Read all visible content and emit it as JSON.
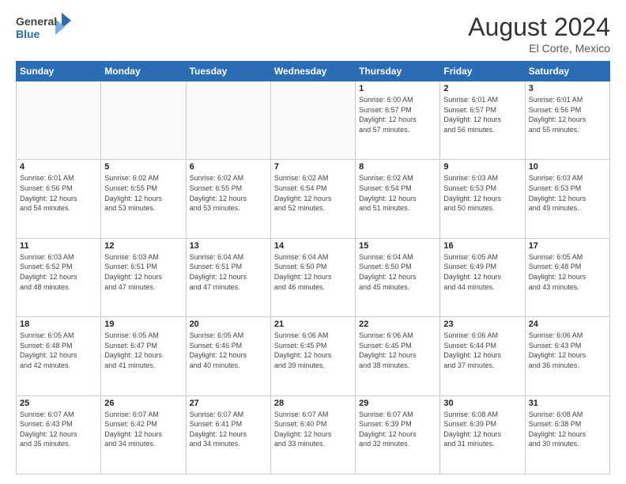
{
  "header": {
    "logo_general": "General",
    "logo_blue": "Blue",
    "month_year": "August 2024",
    "location": "El Corte, Mexico"
  },
  "days": [
    "Sunday",
    "Monday",
    "Tuesday",
    "Wednesday",
    "Thursday",
    "Friday",
    "Saturday"
  ],
  "weeks": [
    [
      {
        "date": "",
        "info": ""
      },
      {
        "date": "",
        "info": ""
      },
      {
        "date": "",
        "info": ""
      },
      {
        "date": "",
        "info": ""
      },
      {
        "date": "1",
        "info": "Sunrise: 6:00 AM\nSunset: 6:57 PM\nDaylight: 12 hours\nand 57 minutes."
      },
      {
        "date": "2",
        "info": "Sunrise: 6:01 AM\nSunset: 6:57 PM\nDaylight: 12 hours\nand 56 minutes."
      },
      {
        "date": "3",
        "info": "Sunrise: 6:01 AM\nSunset: 6:56 PM\nDaylight: 12 hours\nand 55 minutes."
      }
    ],
    [
      {
        "date": "4",
        "info": "Sunrise: 6:01 AM\nSunset: 6:56 PM\nDaylight: 12 hours\nand 54 minutes."
      },
      {
        "date": "5",
        "info": "Sunrise: 6:02 AM\nSunset: 6:55 PM\nDaylight: 12 hours\nand 53 minutes."
      },
      {
        "date": "6",
        "info": "Sunrise: 6:02 AM\nSunset: 6:55 PM\nDaylight: 12 hours\nand 53 minutes."
      },
      {
        "date": "7",
        "info": "Sunrise: 6:02 AM\nSunset: 6:54 PM\nDaylight: 12 hours\nand 52 minutes."
      },
      {
        "date": "8",
        "info": "Sunrise: 6:02 AM\nSunset: 6:54 PM\nDaylight: 12 hours\nand 51 minutes."
      },
      {
        "date": "9",
        "info": "Sunrise: 6:03 AM\nSunset: 6:53 PM\nDaylight: 12 hours\nand 50 minutes."
      },
      {
        "date": "10",
        "info": "Sunrise: 6:03 AM\nSunset: 6:53 PM\nDaylight: 12 hours\nand 49 minutes."
      }
    ],
    [
      {
        "date": "11",
        "info": "Sunrise: 6:03 AM\nSunset: 6:52 PM\nDaylight: 12 hours\nand 48 minutes."
      },
      {
        "date": "12",
        "info": "Sunrise: 6:03 AM\nSunset: 6:51 PM\nDaylight: 12 hours\nand 47 minutes."
      },
      {
        "date": "13",
        "info": "Sunrise: 6:04 AM\nSunset: 6:51 PM\nDaylight: 12 hours\nand 47 minutes."
      },
      {
        "date": "14",
        "info": "Sunrise: 6:04 AM\nSunset: 6:50 PM\nDaylight: 12 hours\nand 46 minutes."
      },
      {
        "date": "15",
        "info": "Sunrise: 6:04 AM\nSunset: 6:50 PM\nDaylight: 12 hours\nand 45 minutes."
      },
      {
        "date": "16",
        "info": "Sunrise: 6:05 AM\nSunset: 6:49 PM\nDaylight: 12 hours\nand 44 minutes."
      },
      {
        "date": "17",
        "info": "Sunrise: 6:05 AM\nSunset: 6:48 PM\nDaylight: 12 hours\nand 43 minutes."
      }
    ],
    [
      {
        "date": "18",
        "info": "Sunrise: 6:05 AM\nSunset: 6:48 PM\nDaylight: 12 hours\nand 42 minutes."
      },
      {
        "date": "19",
        "info": "Sunrise: 6:05 AM\nSunset: 6:47 PM\nDaylight: 12 hours\nand 41 minutes."
      },
      {
        "date": "20",
        "info": "Sunrise: 6:05 AM\nSunset: 6:46 PM\nDaylight: 12 hours\nand 40 minutes."
      },
      {
        "date": "21",
        "info": "Sunrise: 6:06 AM\nSunset: 6:45 PM\nDaylight: 12 hours\nand 39 minutes."
      },
      {
        "date": "22",
        "info": "Sunrise: 6:06 AM\nSunset: 6:45 PM\nDaylight: 12 hours\nand 38 minutes."
      },
      {
        "date": "23",
        "info": "Sunrise: 6:06 AM\nSunset: 6:44 PM\nDaylight: 12 hours\nand 37 minutes."
      },
      {
        "date": "24",
        "info": "Sunrise: 6:06 AM\nSunset: 6:43 PM\nDaylight: 12 hours\nand 36 minutes."
      }
    ],
    [
      {
        "date": "25",
        "info": "Sunrise: 6:07 AM\nSunset: 6:43 PM\nDaylight: 12 hours\nand 35 minutes."
      },
      {
        "date": "26",
        "info": "Sunrise: 6:07 AM\nSunset: 6:42 PM\nDaylight: 12 hours\nand 34 minutes."
      },
      {
        "date": "27",
        "info": "Sunrise: 6:07 AM\nSunset: 6:41 PM\nDaylight: 12 hours\nand 34 minutes."
      },
      {
        "date": "28",
        "info": "Sunrise: 6:07 AM\nSunset: 6:40 PM\nDaylight: 12 hours\nand 33 minutes."
      },
      {
        "date": "29",
        "info": "Sunrise: 6:07 AM\nSunset: 6:39 PM\nDaylight: 12 hours\nand 32 minutes."
      },
      {
        "date": "30",
        "info": "Sunrise: 6:08 AM\nSunset: 6:39 PM\nDaylight: 12 hours\nand 31 minutes."
      },
      {
        "date": "31",
        "info": "Sunrise: 6:08 AM\nSunset: 6:38 PM\nDaylight: 12 hours\nand 30 minutes."
      }
    ]
  ]
}
